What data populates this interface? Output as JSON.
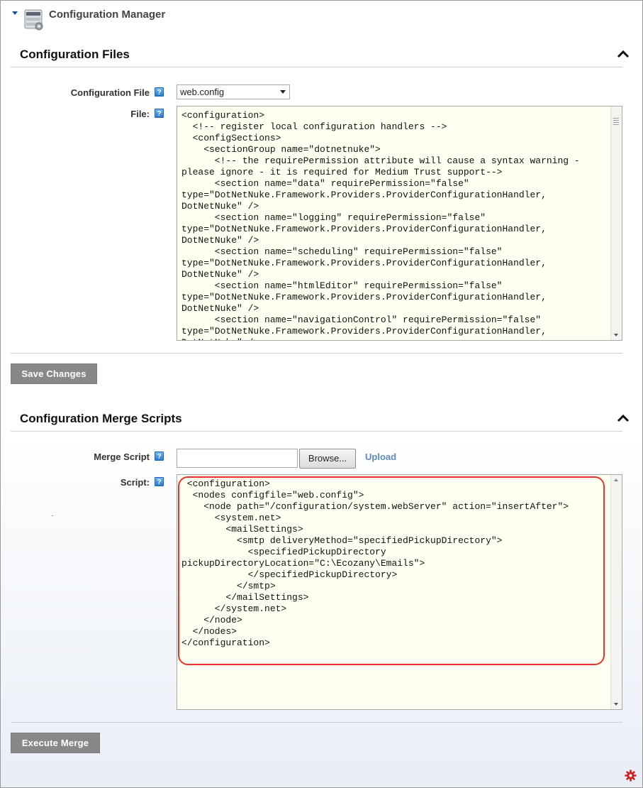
{
  "module": {
    "title": "Configuration Manager",
    "icon": "server-config-icon"
  },
  "config_files": {
    "title": "Configuration Files",
    "collapse_icon": "chevron-up-icon",
    "file_label": "Configuration File",
    "file_selected": "web.config",
    "content_label": "File:",
    "help_glyph": "?",
    "content": "<configuration>\n  <!-- register local configuration handlers -->\n  <configSections>\n    <sectionGroup name=\"dotnetnuke\">\n      <!-- the requirePermission attribute will cause a syntax warning -\nplease ignore - it is required for Medium Trust support-->\n      <section name=\"data\" requirePermission=\"false\"\ntype=\"DotNetNuke.Framework.Providers.ProviderConfigurationHandler,\nDotNetNuke\" />\n      <section name=\"logging\" requirePermission=\"false\"\ntype=\"DotNetNuke.Framework.Providers.ProviderConfigurationHandler,\nDotNetNuke\" />\n      <section name=\"scheduling\" requirePermission=\"false\"\ntype=\"DotNetNuke.Framework.Providers.ProviderConfigurationHandler,\nDotNetNuke\" />\n      <section name=\"htmlEditor\" requirePermission=\"false\"\ntype=\"DotNetNuke.Framework.Providers.ProviderConfigurationHandler,\nDotNetNuke\" />\n      <section name=\"navigationControl\" requirePermission=\"false\"\ntype=\"DotNetNuke.Framework.Providers.ProviderConfigurationHandler,\nDotNetNuke\" />",
    "save_label": "Save Changes"
  },
  "merge_scripts": {
    "title": "Configuration Merge Scripts",
    "collapse_icon": "chevron-up-icon",
    "merge_label": "Merge Script",
    "merge_value": "",
    "browse_label": "Browse...",
    "upload_label": "Upload",
    "script_label": "Script:",
    "help_glyph": "?",
    "script": " <configuration>\n  <nodes configfile=\"web.config\">\n    <node path=\"/configuration/system.webServer\" action=\"insertAfter\">\n      <system.net>\n        <mailSettings>\n          <smtp deliveryMethod=\"specifiedPickupDirectory\">\n            <specifiedPickupDirectory\npickupDirectoryLocation=\"C:\\Ecozany\\Emails\">\n            </specifiedPickupDirectory>\n          </smtp>\n        </mailSettings>\n      </system.net>\n    </node>\n  </nodes>\n</configuration>",
    "execute_label": "Execute Merge",
    "highlight_color": "#e8332c"
  },
  "footer": {
    "settings_icon": "gear-icon",
    "settings_color": "#cc2222"
  }
}
